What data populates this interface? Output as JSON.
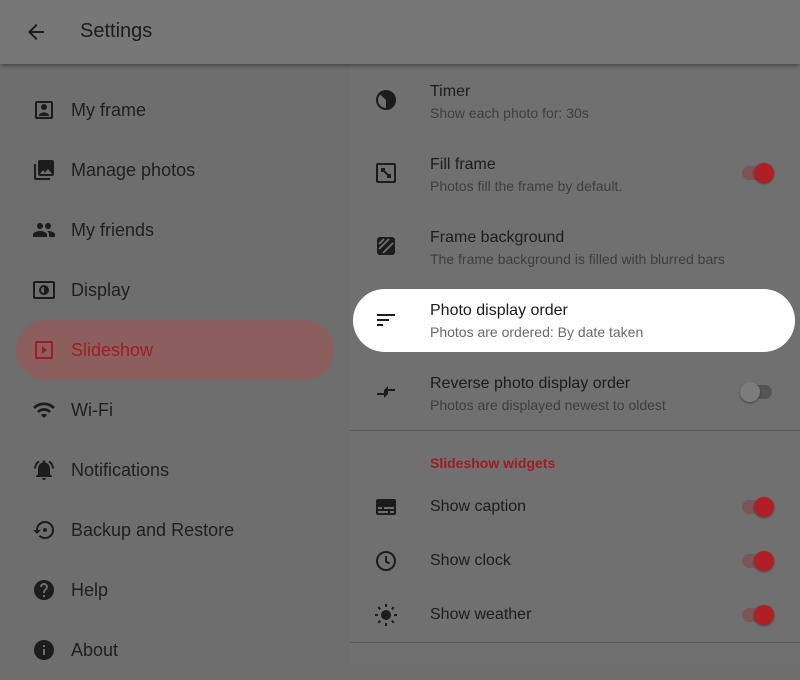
{
  "appbar": {
    "title": "Settings",
    "back_icon": "arrow-back-icon"
  },
  "nav": {
    "items": [
      {
        "label": "My frame",
        "icon": "account-box-icon"
      },
      {
        "label": "Manage photos",
        "icon": "photo-library-icon"
      },
      {
        "label": "My friends",
        "icon": "people-icon"
      },
      {
        "label": "Display",
        "icon": "brightness-display-icon"
      },
      {
        "label": "Slideshow",
        "icon": "slideshow-icon",
        "active": true
      },
      {
        "label": "Wi-Fi",
        "icon": "wifi-icon"
      },
      {
        "label": "Notifications",
        "icon": "notifications-bell-icon"
      },
      {
        "label": "Backup and Restore",
        "icon": "restore-icon"
      },
      {
        "label": "Help",
        "icon": "help-icon"
      },
      {
        "label": "About",
        "icon": "info-icon"
      }
    ]
  },
  "settings": {
    "timer": {
      "title": "Timer",
      "subtitle": "Show each photo for: 30s",
      "icon": "timer-icon"
    },
    "fill_frame": {
      "title": "Fill frame",
      "subtitle": "Photos fill the frame by default.",
      "icon": "fit-screen-icon",
      "enabled": true
    },
    "frame_background": {
      "title": "Frame background",
      "subtitle": "The frame background is filled with blurred bars",
      "icon": "texture-icon"
    },
    "display_order": {
      "title": "Photo display order",
      "subtitle": "Photos are ordered: By date taken",
      "icon": "sort-icon"
    },
    "reverse_order": {
      "title": "Reverse photo display order",
      "subtitle": "Photos are displayed newest to oldest",
      "icon": "swap-arrows-icon",
      "enabled": false
    }
  },
  "widgets": {
    "header": "Slideshow widgets",
    "show_caption": {
      "title": "Show caption",
      "icon": "subtitles-icon",
      "enabled": true
    },
    "show_clock": {
      "title": "Show clock",
      "icon": "clock-icon",
      "enabled": true
    },
    "show_weather": {
      "title": "Show weather",
      "icon": "sun-icon",
      "enabled": true
    }
  },
  "colors": {
    "accent": "#a01c22",
    "active_nav_bg": "#8c5f5f",
    "highlight": "#ffffff"
  }
}
